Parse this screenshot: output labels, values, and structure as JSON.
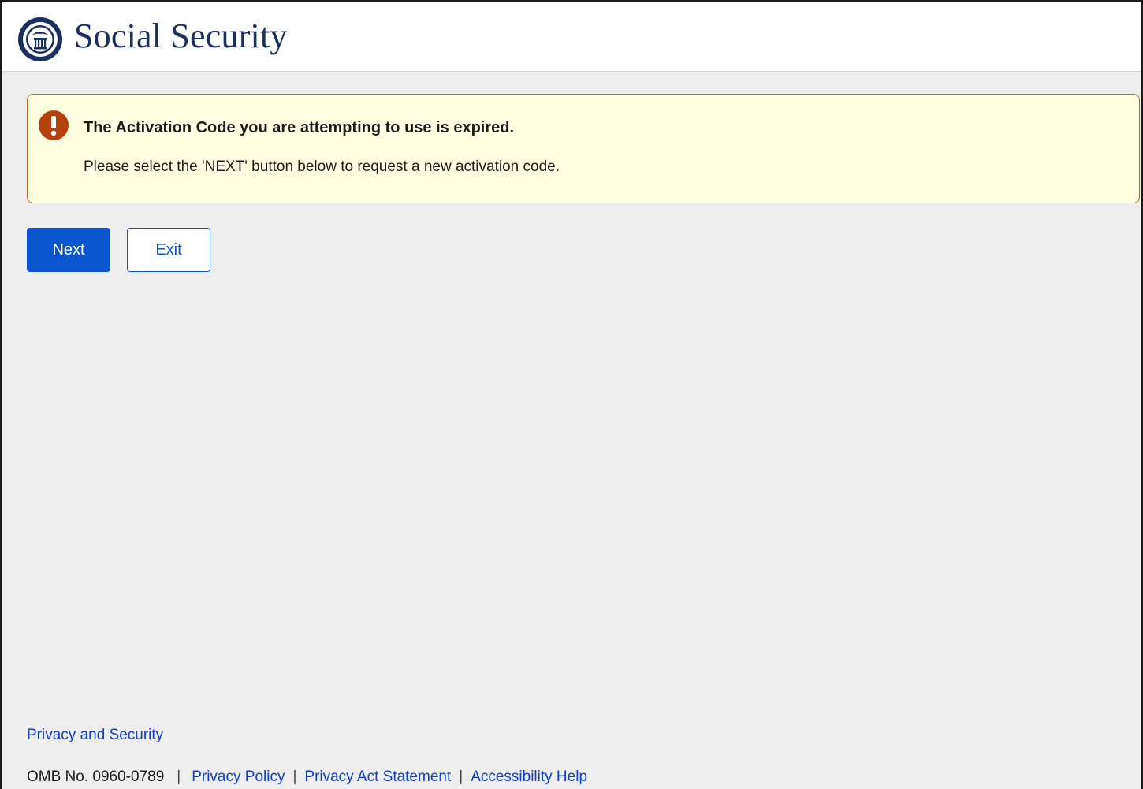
{
  "header": {
    "title": "Social Security",
    "seal_icon": "ssa-seal-icon"
  },
  "alert": {
    "icon": "exclamation-icon",
    "title": "The Activation Code you are attempting to use is expired.",
    "message": "Please select the 'NEXT' button below to request a new activation code.",
    "colors": {
      "background": "#fffee0",
      "border": "#c26b24",
      "icon": "#b5420c"
    }
  },
  "actions": {
    "next_label": "Next",
    "exit_label": "Exit",
    "primary_color": "#0b55cf"
  },
  "footer": {
    "privacy_security": "Privacy and Security",
    "omb": "OMB No. 0960-0789",
    "separator": "|",
    "privacy_policy": "Privacy Policy",
    "privacy_act": "Privacy Act Statement",
    "accessibility": "Accessibility Help"
  }
}
